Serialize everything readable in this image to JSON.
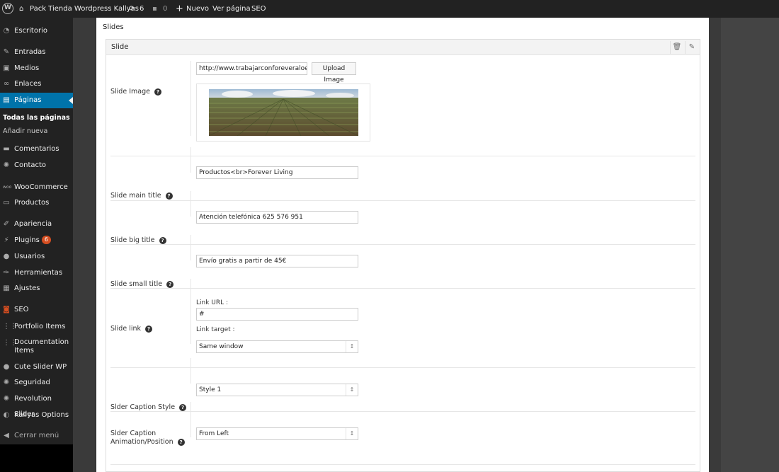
{
  "adminbar": {
    "site_name": "Pack Tienda Wordpress Kallyas",
    "updates_count": "6",
    "comments_count": "0",
    "new_label": "Nuevo",
    "view_page_label": "Ver página",
    "seo_label": "SEO"
  },
  "sidebar": {
    "items": [
      {
        "label": "Escritorio",
        "icon": "dashboard-icon"
      },
      {
        "label": "Entradas",
        "icon": "pin-icon"
      },
      {
        "label": "Medios",
        "icon": "media-icon"
      },
      {
        "label": "Enlaces",
        "icon": "link-icon"
      },
      {
        "label": "Páginas",
        "icon": "page-icon",
        "active": true
      },
      {
        "label": "Comentarios",
        "icon": "comment-icon"
      },
      {
        "label": "Contacto",
        "icon": "gear-icon"
      },
      {
        "label": "WooCommerce",
        "icon": "woo-icon"
      },
      {
        "label": "Productos",
        "icon": "archive-icon"
      },
      {
        "label": "Apariencia",
        "icon": "brush-icon"
      },
      {
        "label": "Plugins",
        "icon": "plug-icon",
        "badge": "6"
      },
      {
        "label": "Usuarios",
        "icon": "user-icon"
      },
      {
        "label": "Herramientas",
        "icon": "wrench-icon"
      },
      {
        "label": "Ajustes",
        "icon": "settings-icon"
      },
      {
        "label": "SEO",
        "icon": "seo-icon"
      },
      {
        "label": "Portfolio Items",
        "icon": "grid-icon"
      },
      {
        "label": "Documentation",
        "label2": "Items",
        "icon": "grid-icon"
      },
      {
        "label": "Cute Slider WP",
        "icon": "slider-icon"
      },
      {
        "label": "Seguridad",
        "icon": "gear-icon"
      },
      {
        "label": "Revolution Slider",
        "icon": "gear-icon"
      },
      {
        "label": "Kallyas Options",
        "icon": "kallyas-icon"
      },
      {
        "label": "Cerrar menú",
        "icon": "collapse-icon"
      }
    ],
    "submenu": [
      "Todas las páginas",
      "Añadir nueva"
    ]
  },
  "panel": {
    "title": "Slides",
    "slide_header": "Slide",
    "rows": {
      "image": {
        "label": "Slide Image",
        "value": "http://www.trabajarconforeveraloever",
        "button": "Upload Image"
      },
      "main_title": {
        "label": "Slide main title",
        "value": "Productos<br>Forever Living"
      },
      "big_title": {
        "label": "Slide big title",
        "value": "Atención telefónica 625 576 951"
      },
      "small_title": {
        "label": "Slide small title",
        "value": "Envío gratis a partir de 45€"
      },
      "link": {
        "label": "Slide link",
        "url_label": "Link URL :",
        "url_value": "#",
        "target_label": "Link target :",
        "target_value": "Same window"
      },
      "caption_style": {
        "label": "Slder Caption Style",
        "value": "Style 1"
      },
      "caption_anim": {
        "label1": "Slder Caption",
        "label2": "Animation/Position",
        "value": "From Left"
      }
    }
  }
}
